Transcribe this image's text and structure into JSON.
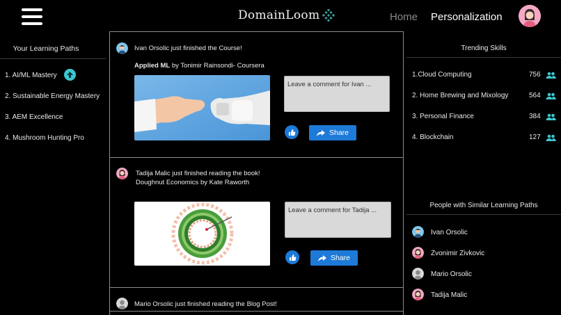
{
  "header": {
    "logo_text": "DomainLoom",
    "nav_home": "Home",
    "nav_personalization": "Personalization"
  },
  "left": {
    "title": "Your Learning Paths",
    "paths": [
      {
        "label": "1. AI/ML Mastery"
      },
      {
        "label": "2. Sustainable Energy Mastery"
      },
      {
        "label": "3. AEM Excellence"
      },
      {
        "label": "4. Mushroom Hunting Pro"
      }
    ]
  },
  "feed": {
    "posts": [
      {
        "text": "Ivan Orsolic just finished the Course!",
        "course_title": "Applied ML",
        "course_meta": " by Tonimir Rainsondi- Coursera",
        "comment_placeholder": "Leave a comment for Ivan ...",
        "share_label": "Share"
      },
      {
        "text_line1": "Tadija Malic just finished reading the book!",
        "text_line2": "Doughnut Economics by Kate Raworth",
        "comment_placeholder": "Leave a comment for Tadija ...",
        "share_label": "Share"
      },
      {
        "text": "Mario Orsolic just finished reading the Blog Post!"
      }
    ]
  },
  "right": {
    "skills_title": "Trending Skills",
    "skills": [
      {
        "name": "1.Cloud Computing",
        "count": "756"
      },
      {
        "name": "2. Home Brewing and Mixology",
        "count": "564"
      },
      {
        "name": "3. Personal Finance",
        "count": "384"
      },
      {
        "name": "4. Blockchain",
        "count": "127"
      }
    ],
    "people_title": "People with Similar Learning Paths",
    "people": [
      {
        "name": "Ivan Orsolic"
      },
      {
        "name": "Zvonimir Zivkovic"
      },
      {
        "name": "Mario Orsolic"
      },
      {
        "name": "Tadija Malic"
      }
    ]
  },
  "colors": {
    "background": "#000000",
    "accent_blue": "#1e7ad8",
    "teal": "#3cc7d0",
    "comment_bg": "#d9d9d9"
  },
  "icons": [
    "menu-icon",
    "logo-icon",
    "avatar",
    "arrow-up-icon",
    "thumbs-up-icon",
    "share-arrow-icon",
    "people-icon"
  ]
}
